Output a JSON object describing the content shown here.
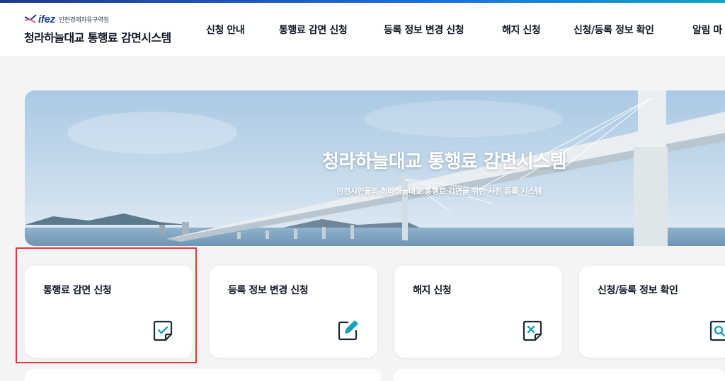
{
  "header": {
    "logo_text": "ifez",
    "org_name": "인천경제자유구역청",
    "site_title": "청라하늘대교 통행료 감면시스템"
  },
  "nav": {
    "items": [
      {
        "label": "신청 안내"
      },
      {
        "label": "통행료 감면 신청"
      },
      {
        "label": "등록 정보 변경 신청"
      },
      {
        "label": "해지 신청"
      },
      {
        "label": "신청/등록 정보 확인"
      },
      {
        "label": "알림 마"
      }
    ]
  },
  "banner": {
    "title": "청라하늘대교 통행료 감면시스템",
    "subtitle": "인천시민들의 청라하늘대교 통행료 감면을 위한 사전 등록 시스템"
  },
  "cards": [
    {
      "label": "통행료 감면 신청",
      "icon": "check-note-icon"
    },
    {
      "label": "등록 정보 변경 신청",
      "icon": "edit-pencil-icon"
    },
    {
      "label": "해지 신청",
      "icon": "cancel-note-icon"
    },
    {
      "label": "신청/등록 정보 확인",
      "icon": "search-note-icon"
    }
  ],
  "colors": {
    "accent": "#1d3f8f",
    "icon_teal": "#17a2b8",
    "highlight": "#e53935"
  }
}
